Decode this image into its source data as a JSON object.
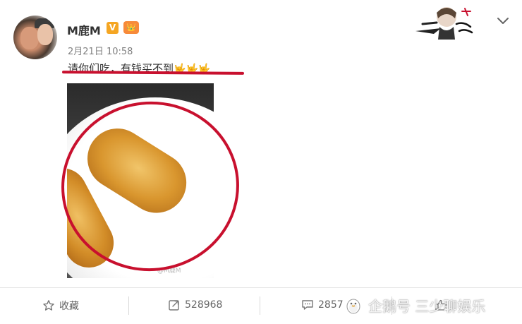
{
  "post": {
    "username": "M鹿M",
    "verified_badge": "V",
    "crown_badge": "👑",
    "timestamp": "2月21日 10:58",
    "text": "请你们吃，有钱买不到",
    "text_emojis": "🤟🤟🤟",
    "photo_watermark": "@M鹿M"
  },
  "actions": {
    "collect_label": "收藏",
    "repost_count": "528968",
    "comment_count": "2857",
    "like_count": ""
  },
  "watermark": {
    "text": "企鹅号 三少聊娱乐"
  },
  "icons": {
    "collect": "star-icon",
    "repost": "repost-icon",
    "comment": "comment-icon",
    "like": "thumbs-up-icon",
    "menu": "chevron-down-icon"
  },
  "colors": {
    "highlight_red": "#c8102e",
    "verified_orange": "#f5a623",
    "text_gray": "#808080"
  }
}
